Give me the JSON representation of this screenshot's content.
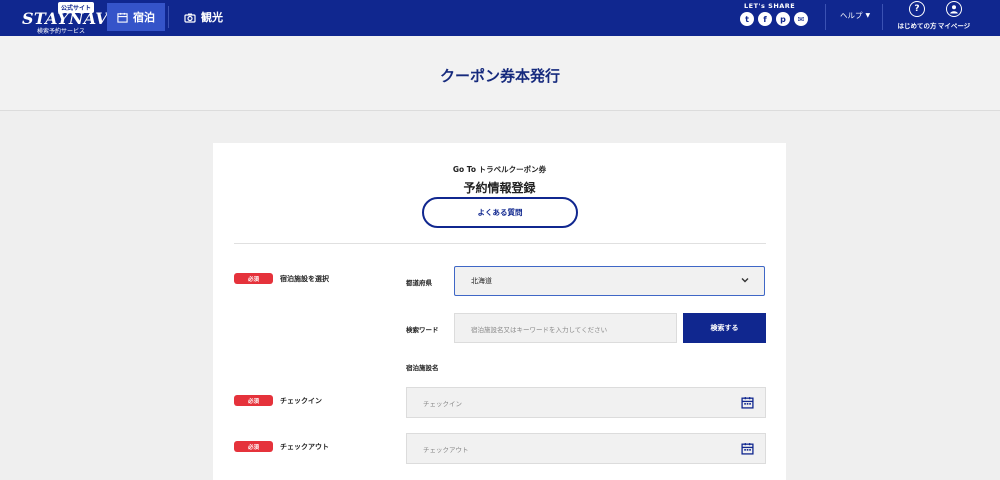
{
  "header": {
    "logo": {
      "badge": "公式サイト",
      "wordmark": "STAYNAVI",
      "subtitle": "検索予約サービス"
    },
    "tabs": [
      {
        "label": "宿泊",
        "icon": "calendar-icon",
        "active": true
      },
      {
        "label": "観光",
        "icon": "camera-icon",
        "active": false
      }
    ],
    "share": {
      "label": "LET's SHARE",
      "icons": [
        {
          "name": "twitter-icon",
          "glyph": "t"
        },
        {
          "name": "facebook-icon",
          "glyph": "f"
        },
        {
          "name": "pinterest-icon",
          "glyph": "p"
        },
        {
          "name": "line-icon",
          "glyph": "✉"
        }
      ]
    },
    "help_label": "ヘルプ",
    "first_time_label": "はじめての方",
    "mypage_label": "マイページ"
  },
  "page": {
    "title": "クーポン券本発行"
  },
  "card": {
    "eyebrow": "Go To トラベルクーポン券",
    "title": "予約情報登録",
    "faq_button": "よくある質問"
  },
  "form": {
    "required_badge": "必須",
    "facility": {
      "label": "宿泊施設を選択",
      "prefecture_label": "都道府県",
      "prefecture_value": "北海道",
      "keyword_label": "検索ワード",
      "keyword_placeholder": "宿泊施設名又はキーワードを入力してください",
      "search_button": "検索する",
      "facility_name_label": "宿泊施設名"
    },
    "checkin": {
      "label": "チェックイン",
      "placeholder": "チェックイン"
    },
    "checkout": {
      "label": "チェックアウト",
      "placeholder": "チェックアウト"
    }
  },
  "colors": {
    "brand": "#10278f",
    "active_tab": "#3554c9",
    "required": "#e5323b"
  }
}
